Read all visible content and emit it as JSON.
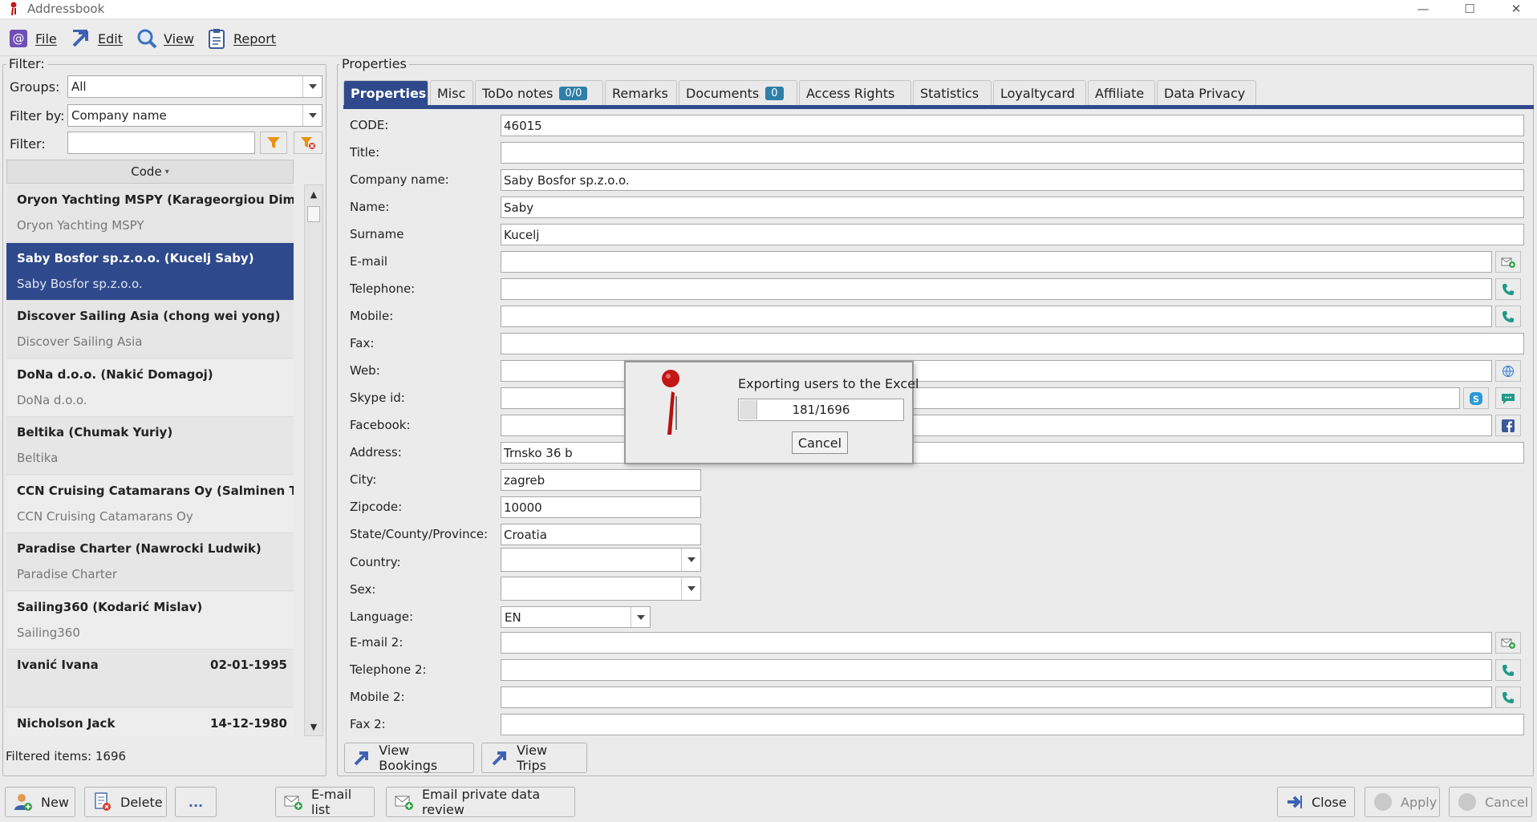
{
  "window": {
    "title": "Addressbook"
  },
  "menu": {
    "file": "File",
    "edit": "Edit",
    "view": "View",
    "report": "Report"
  },
  "filter": {
    "legend": "Filter:",
    "groups_label": "Groups:",
    "groups_value": "All",
    "filter_by_label": "Filter by:",
    "filter_by_value": "Company name",
    "filter_label": "Filter:",
    "filter_value": ""
  },
  "list": {
    "column_header": "Code",
    "items": [
      {
        "line1": "Oryon Yachting MSPY (Karageorgiou Dimitrios",
        "line2": "Oryon Yachting MSPY",
        "date": ""
      },
      {
        "line1": "Saby Bosfor sp.z.o.o. (Kucelj Saby)",
        "line2": "Saby Bosfor sp.z.o.o.",
        "date": ""
      },
      {
        "line1": "Discover Sailing Asia (chong wei yong)",
        "line2": "Discover Sailing Asia",
        "date": ""
      },
      {
        "line1": "DoNa d.o.o. (Nakić Domagoj)",
        "line2": "DoNa d.o.o.",
        "date": ""
      },
      {
        "line1": "Beltika  (Chumak Yuriy)",
        "line2": "Beltika",
        "date": ""
      },
      {
        "line1": "CCN Cruising Catamarans Oy (Salminen Timo)",
        "line2": "CCN Cruising Catamarans Oy",
        "date": ""
      },
      {
        "line1": "Paradise Charter (Nawrocki Ludwik)",
        "line2": "Paradise Charter",
        "date": ""
      },
      {
        "line1": "Sailing360 (Kodarić Mislav)",
        "line2": "Sailing360",
        "date": ""
      },
      {
        "line1": "Ivanić Ivana",
        "line2": "",
        "date": "02-01-1995"
      },
      {
        "line1": "Nicholson Jack",
        "line2": "",
        "date": "14-12-1980"
      }
    ],
    "selected_index": 1,
    "status": "Filtered items: 1696"
  },
  "properties": {
    "legend": "Properties",
    "tabs": [
      {
        "label": "Properties",
        "badge": ""
      },
      {
        "label": "Misc",
        "badge": ""
      },
      {
        "label": "ToDo notes",
        "badge": "0/0"
      },
      {
        "label": "Remarks",
        "badge": ""
      },
      {
        "label": "Documents",
        "badge": "0"
      },
      {
        "label": "Access Rights",
        "badge": ""
      },
      {
        "label": "Statistics",
        "badge": ""
      },
      {
        "label": "Loyaltycard",
        "badge": ""
      },
      {
        "label": "Affiliate",
        "badge": ""
      },
      {
        "label": "Data Privacy",
        "badge": ""
      }
    ],
    "fields": {
      "code": {
        "label": "CODE:",
        "value": "46015"
      },
      "title": {
        "label": "Title:",
        "value": ""
      },
      "company": {
        "label": "Company name:",
        "value": "Saby Bosfor sp.z.o.o."
      },
      "name": {
        "label": "Name:",
        "value": "Saby"
      },
      "surname": {
        "label": "Surname",
        "value": "Kucelj"
      },
      "email": {
        "label": "E-mail",
        "value": ""
      },
      "telephone": {
        "label": "Telephone:",
        "value": ""
      },
      "mobile": {
        "label": "Mobile:",
        "value": ""
      },
      "fax": {
        "label": "Fax:",
        "value": ""
      },
      "web": {
        "label": "Web:",
        "value": ""
      },
      "skype": {
        "label": "Skype id:",
        "value": ""
      },
      "facebook": {
        "label": "Facebook:",
        "value": ""
      },
      "address": {
        "label": "Address:",
        "value": "Trnsko 36 b"
      },
      "city": {
        "label": "City:",
        "value": "zagreb"
      },
      "zipcode": {
        "label": "Zipcode:",
        "value": "10000"
      },
      "state": {
        "label": "State/County/Province:",
        "value": "Croatia"
      },
      "country": {
        "label": "Country:",
        "value": ""
      },
      "sex": {
        "label": "Sex:",
        "value": ""
      },
      "language": {
        "label": "Language:",
        "value": "EN"
      },
      "email2": {
        "label": "E-mail 2:",
        "value": ""
      },
      "telephone2": {
        "label": "Telephone 2:",
        "value": ""
      },
      "mobile2": {
        "label": "Mobile 2:",
        "value": ""
      },
      "fax2": {
        "label": "Fax 2:",
        "value": ""
      }
    },
    "view_bookings": "View Bookings",
    "view_trips": "View Trips"
  },
  "bottom": {
    "new": "New",
    "delete": "Delete",
    "more": "...",
    "email_list": "E-mail list",
    "email_private": "Email private data review",
    "close": "Close",
    "apply": "Apply",
    "cancel": "Cancel"
  },
  "dialog": {
    "message": "Exporting users to the Excel",
    "progress_text": "181/1696",
    "progress_fraction": 0.107,
    "cancel": "Cancel"
  },
  "colors": {
    "accent": "#2f4a8c",
    "badge": "#2f7fa8",
    "background": "#ebebeb"
  }
}
